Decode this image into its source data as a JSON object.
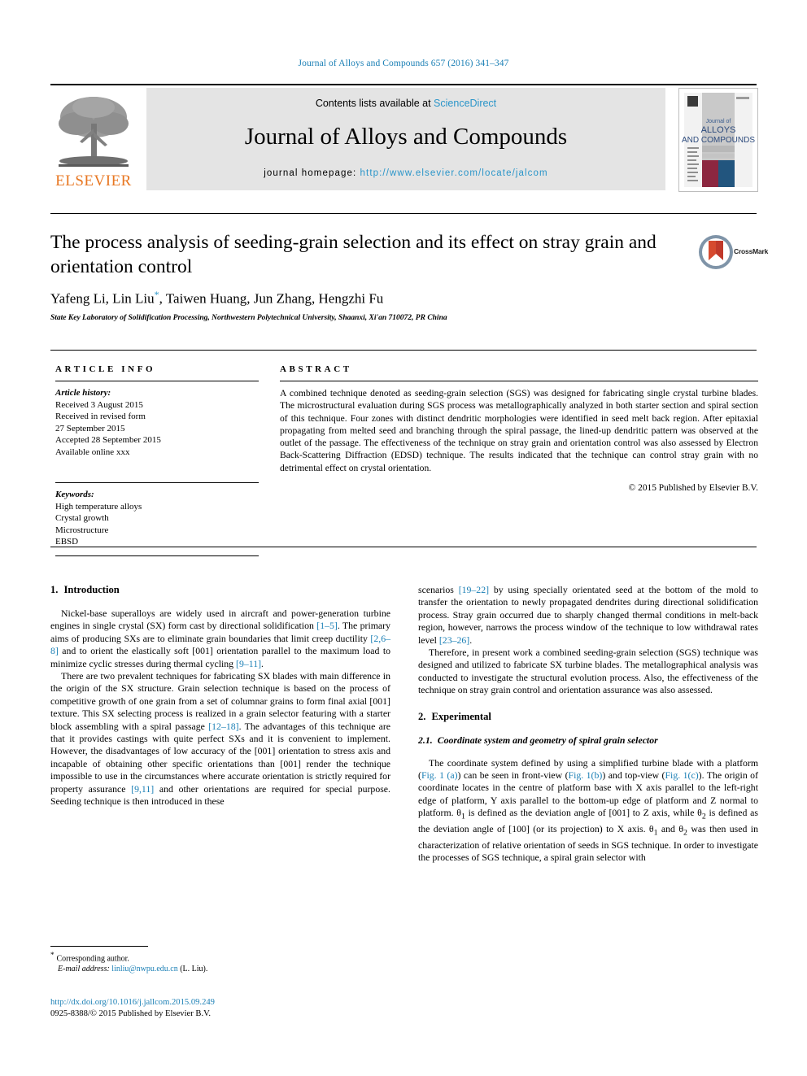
{
  "running_head": "Journal of Alloys and Compounds 657 (2016) 341–347",
  "masthead": {
    "contents_prefix": "Contents lists available at ",
    "sciencedirect": "ScienceDirect",
    "journal_title": "Journal of Alloys and Compounds",
    "homepage_prefix": "journal homepage: ",
    "homepage_url": "http://www.elsevier.com/locate/jalcom",
    "publisher_wordmark": "ELSEVIER",
    "cover_title_line1": "Journal of",
    "cover_title_line2": "ALLOYS",
    "cover_title_line3": "AND COMPOUNDS"
  },
  "colors": {
    "link_blue": "#1a7fb5",
    "sciencedirect_blue": "#2a95c9",
    "elsevier_orange": "#e87722",
    "cover_maroon": "#8c2740",
    "cover_navy": "#22557e",
    "masthead_gray": "#e4e4e4"
  },
  "article": {
    "title": "The process analysis of seeding-grain selection and its effect on stray grain and orientation control",
    "crossmark_label": "CrossMark",
    "authors": "Yafeng Li, Lin Liu",
    "authors_rest": ", Taiwen Huang, Jun Zhang, Hengzhi Fu",
    "corresponding_marker": "*",
    "affiliation": "State Key Laboratory of Solidification Processing, Northwestern Polytechnical University, Shaanxi, Xi'an 710072, PR China"
  },
  "article_info": {
    "heading": "ARTICLE INFO",
    "history_label": "Article history:",
    "history_lines": [
      "Received 3 August 2015",
      "Received in revised form",
      "27 September 2015",
      "Accepted 28 September 2015",
      "Available online xxx"
    ],
    "keywords_label": "Keywords:",
    "keywords": [
      "High temperature alloys",
      "Crystal growth",
      "Microstructure",
      "EBSD"
    ]
  },
  "abstract": {
    "heading": "ABSTRACT",
    "body": "A combined technique denoted as seeding-grain selection (SGS) was designed for fabricating single crystal turbine blades. The microstructural evaluation during SGS process was metallographically analyzed in both starter section and spiral section of this technique. Four zones with distinct dendritic morphologies were identified in seed melt back region. After epitaxial propagating from melted seed and branching through the spiral passage, the lined-up dendritic pattern was observed at the outlet of the passage. The effectiveness of the technique on stray grain and orientation control was also assessed by Electron Back-Scattering Diffraction (EDSD) technique. The results indicated that the technique can control stray grain with no detrimental effect on crystal orientation.",
    "copyright": "© 2015 Published by Elsevier B.V."
  },
  "body": {
    "intro_num": "1.",
    "intro_heading": "Introduction",
    "experimental_num": "2.",
    "experimental_heading": "Experimental",
    "subsection_num": "2.1.",
    "subsection_heading": "Coordinate system and geometry of spiral grain selector",
    "left_p1_a": "Nickel-base superalloys are widely used in aircraft and power-generation turbine engines in single crystal (SX) form cast by directional solidification ",
    "left_p1_ref1": "[1–5]",
    "left_p1_b": ". The primary aims of producing SXs are to eliminate grain boundaries that limit creep ductility ",
    "left_p1_ref2": "[2,6–8]",
    "left_p1_c": " and to orient the elastically soft [001] orientation parallel to the maximum load to minimize cyclic stresses during thermal cycling ",
    "left_p1_ref3": "[9–11]",
    "left_p1_d": ".",
    "left_p2_a": "There are two prevalent techniques for fabricating SX blades with main difference in the origin of the SX structure. Grain selection technique is based on the process of competitive growth of one grain from a set of columnar grains to form final axial [001] texture. This SX selecting process is realized in a grain selector featuring with a starter block assembling with a spiral passage ",
    "left_p2_ref1": "[12–18]",
    "left_p2_b": ". The advantages of this technique are that it provides castings with quite perfect SXs and it is convenient to implement. However, the disadvantages of low accuracy of the [001] orientation to stress axis and incapable of obtaining other specific orientations than [001] render the technique impossible to use in the circumstances where accurate orientation is strictly required for property assurance ",
    "left_p2_ref2": "[9,11]",
    "left_p2_c": " and other orientations are required for special purpose. Seeding technique is then introduced in these",
    "right_p1_a": "scenarios ",
    "right_p1_ref1": "[19–22]",
    "right_p1_b": " by using specially orientated seed at the bottom of the mold to transfer the orientation to newly propagated dendrites during directional solidification process. Stray grain occurred due to sharply changed thermal conditions in melt-back region, however, narrows the process window of the technique to low withdrawal rates level ",
    "right_p1_ref2": "[23–26]",
    "right_p1_c": ".",
    "right_p2": "Therefore, in present work a combined seeding-grain selection (SGS) technique was designed and utilized to fabricate SX turbine blades. The metallographical analysis was conducted to investigate the structural evolution process. Also, the effectiveness of the technique on stray grain control and orientation assurance was also assessed.",
    "right_p3_a": "The coordinate system defined by using a simplified turbine blade with a platform (",
    "right_p3_fig1a": "Fig. 1 (a)",
    "right_p3_b": ") can be seen in front-view (",
    "right_p3_fig1b": "Fig. 1(b)",
    "right_p3_c": ") and top-view (",
    "right_p3_fig1c": "Fig. 1(c)",
    "right_p3_d": "). The origin of coordinate locates in the centre of platform base with X axis parallel to the left-right edge of platform, Y axis parallel to the bottom-up edge of platform and Z normal to platform. θ",
    "right_p3_sub1": "1",
    "right_p3_e": " is defined as the deviation angle of [001] to Z axis, while θ",
    "right_p3_sub2": "2",
    "right_p3_f": " is defined as the deviation angle of [100] (or its projection) to X axis. θ",
    "right_p3_sub3": "1",
    "right_p3_g": " and θ",
    "right_p3_sub4": "2",
    "right_p3_h": " was then used in characterization of relative orientation of seeds in SGS technique. In order to investigate the processes of SGS technique, a spiral grain selector with"
  },
  "footnote": {
    "corresponding_star": "*",
    "corresponding_text": "Corresponding author.",
    "email_label": "E-mail address:",
    "email": "linliu@nwpu.edu.cn",
    "email_suffix": " (L. Liu).",
    "doi": "http://dx.doi.org/10.1016/j.jallcom.2015.09.249",
    "issn_line": "0925-8388/© 2015 Published by Elsevier B.V."
  }
}
